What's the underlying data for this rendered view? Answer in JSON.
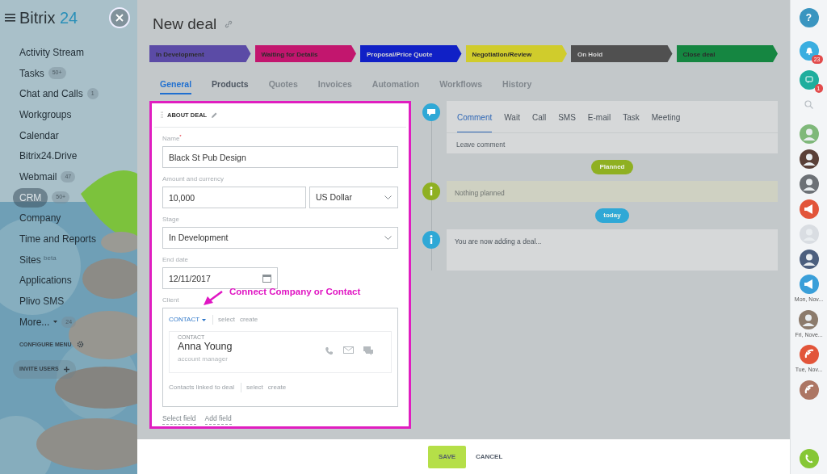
{
  "sidebar": {
    "logo": {
      "name": "Bitrix",
      "accent": "24"
    },
    "items": [
      {
        "label": "Activity Stream",
        "selected": false
      },
      {
        "label": "Tasks",
        "counter": "50+",
        "selected": false
      },
      {
        "label": "Chat and Calls",
        "counter": "1",
        "selected": false
      },
      {
        "label": "Workgroups",
        "selected": false
      },
      {
        "label": "Calendar",
        "selected": false
      },
      {
        "label": "Bitrix24.Drive",
        "selected": false
      },
      {
        "label": "Webmail",
        "counter": "47",
        "selected": false
      },
      {
        "label": "CRM",
        "counter": "50+",
        "selected": true
      },
      {
        "label": "Company",
        "selected": false
      },
      {
        "label": "Time and Reports",
        "selected": false
      },
      {
        "label": "Sites",
        "tag": "beta",
        "selected": false
      },
      {
        "label": "Applications",
        "selected": false
      },
      {
        "label": "Plivo SMS",
        "selected": false
      },
      {
        "label": "More...",
        "counter": "24",
        "kind": "more",
        "selected": false
      }
    ],
    "configure": "CONFIGURE MENU",
    "invite": "INVITE USERS"
  },
  "deal": {
    "title": "New deal",
    "stages": [
      {
        "label": "In Development",
        "color": "#5b4ba6"
      },
      {
        "label": "Waiting for Details",
        "color": "#c2166e"
      },
      {
        "label": "Proposal/Price Quote",
        "color": "#1020c6"
      },
      {
        "label": "Negotiation/Review",
        "color": "#d0cc2c"
      },
      {
        "label": "On Hold",
        "color": "#505050"
      },
      {
        "label": "Close deal",
        "color": "#158641"
      }
    ],
    "tabs": [
      {
        "label": "General",
        "selected": true,
        "disabled": false
      },
      {
        "label": "Products",
        "selected": false,
        "disabled": false
      },
      {
        "label": "Quotes",
        "selected": false,
        "disabled": true
      },
      {
        "label": "Invoices",
        "selected": false,
        "disabled": true
      },
      {
        "label": "Automation",
        "selected": false,
        "disabled": true
      },
      {
        "label": "Workflows",
        "selected": false,
        "disabled": true
      },
      {
        "label": "History",
        "selected": false,
        "disabled": true
      }
    ],
    "about": {
      "title": "ABOUT DEAL",
      "name_label": "Name$^{*}$",
      "name_value": "Black St Pub Design",
      "amount_label": "Amount and currency",
      "amount_value": "10,000",
      "currency_value": "US Dollar",
      "stage_label": "Stage",
      "stage_value": "In Development",
      "end_label": "End date",
      "end_value": "12/11/2017",
      "client_label": "Client",
      "client": {
        "type": "CONTACT",
        "select": "select",
        "create": "create",
        "contact": {
          "caption": "CONTACT",
          "name": "Anna Young",
          "role": "account manager"
        },
        "linked_label": "Contacts linked to deal",
        "linked_select": "select",
        "linked_create": "create"
      },
      "links": [
        "Select field",
        "Add field"
      ],
      "annotation": "Connect Company or Contact"
    },
    "timeline": {
      "tabs": [
        {
          "label": "Comment",
          "selected": true
        },
        {
          "label": "Wait",
          "selected": false
        },
        {
          "label": "Call",
          "selected": false
        },
        {
          "label": "SMS",
          "selected": false
        },
        {
          "label": "E-mail",
          "selected": false
        },
        {
          "label": "Task",
          "selected": false
        },
        {
          "label": "Meeting",
          "selected": false
        }
      ],
      "comment_placeholder": "Leave comment",
      "entries": [
        {
          "kind": "badge",
          "text": "Planned",
          "color": "#8fb022"
        },
        {
          "kind": "item",
          "text": "Nothing planned",
          "color": "#8fb022"
        },
        {
          "kind": "badge",
          "text": "today",
          "color": "#2fa8d6"
        },
        {
          "kind": "item",
          "text": "You are now adding a deal...",
          "color": "#2fa8d6"
        }
      ]
    },
    "footer": {
      "save": "SAVE",
      "cancel": "CANCEL"
    }
  },
  "right_bar": {
    "help": "?",
    "notifications": "23",
    "chats": "1",
    "contacts": [
      {
        "kind": "avatar",
        "color": "#7fb87a"
      },
      {
        "kind": "avatar",
        "color": "#5a4038"
      },
      {
        "kind": "avatar",
        "color": "#6c7176"
      },
      {
        "kind": "megaphone",
        "color": "#e2553a"
      },
      {
        "kind": "avatar",
        "color": "#d9dde2"
      },
      {
        "kind": "avatar",
        "color": "#4c5f7e"
      },
      {
        "kind": "megaphone",
        "color": "#3a9fd9",
        "caption": "Mon, Nov..."
      },
      {
        "kind": "avatar",
        "color": "#8c7b6c",
        "caption": "Fri, Nove..."
      },
      {
        "kind": "phone",
        "color": "#e2553a",
        "caption": "Tue, Nov..."
      },
      {
        "kind": "phone",
        "color": "#ac7664"
      }
    ]
  }
}
